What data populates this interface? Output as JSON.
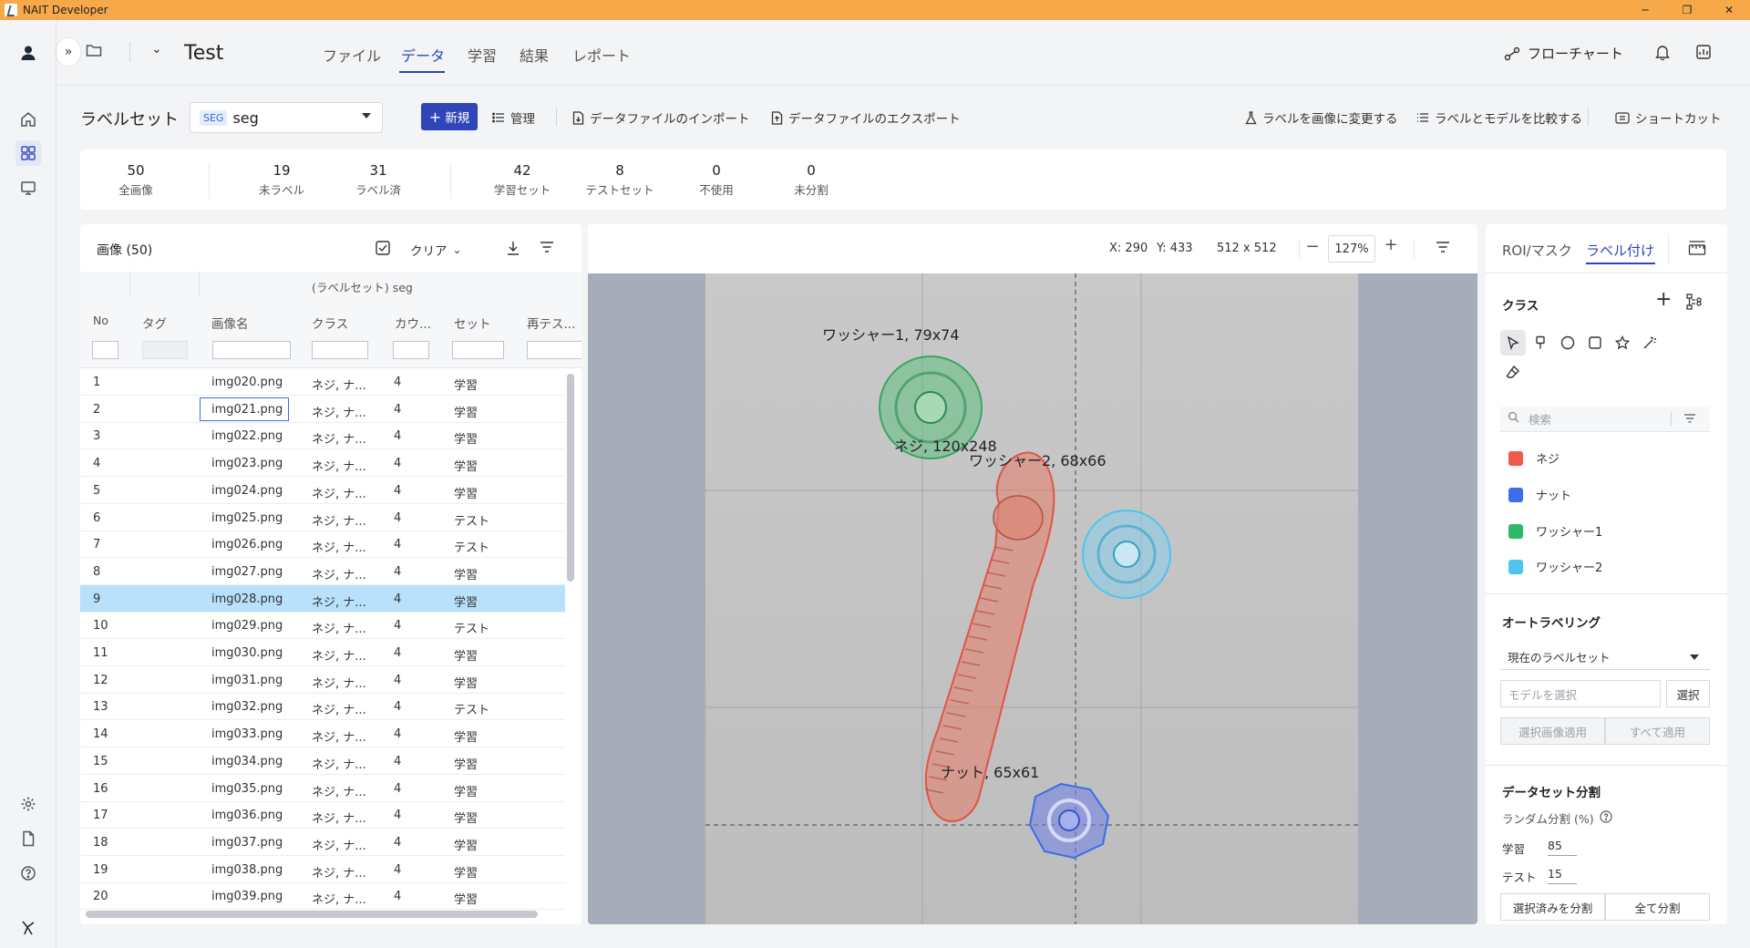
{
  "window": {
    "title": "NAIT Developer",
    "minimize": "─",
    "restore": "❐",
    "close": "✕"
  },
  "header": {
    "project": "Test",
    "menu": [
      "ファイル",
      "データ",
      "学習",
      "結果",
      "レポート"
    ],
    "flowchart": "フローチャート"
  },
  "toolbar": {
    "title": "ラベルセット",
    "badge": "SEG",
    "selected": "seg",
    "new": "新規",
    "manage": "管理",
    "import": "データファイルのインポート",
    "export": "データファイルのエクスポート",
    "change_to_image": "ラベルを画像に変更する",
    "compare": "ラベルとモデルを比較する",
    "shortcut": "ショートカット"
  },
  "stats": [
    {
      "num": "50",
      "label": "全画像"
    },
    {
      "num": "19",
      "label": "未ラベル"
    },
    {
      "num": "31",
      "label": "ラベル済"
    },
    {
      "num": "42",
      "label": "学習セット"
    },
    {
      "num": "8",
      "label": "テストセット"
    },
    {
      "num": "0",
      "label": "不使用"
    },
    {
      "num": "0",
      "label": "未分割"
    }
  ],
  "list": {
    "title": "画像 (50)",
    "clear": "クリア",
    "group_header": "(ラベルセット) seg",
    "columns": [
      "No",
      "タグ",
      "画像名",
      "クラス",
      "カウ...",
      "セット",
      "再テス..."
    ],
    "rows": [
      {
        "no": "1",
        "name": "img020.png",
        "cls": "ネジ, ナ...",
        "count": "4",
        "set": "学習"
      },
      {
        "no": "2",
        "name": "img021.png",
        "cls": "ネジ, ナ...",
        "count": "4",
        "set": "学習"
      },
      {
        "no": "3",
        "name": "img022.png",
        "cls": "ネジ, ナ...",
        "count": "4",
        "set": "学習"
      },
      {
        "no": "4",
        "name": "img023.png",
        "cls": "ネジ, ナ...",
        "count": "4",
        "set": "学習"
      },
      {
        "no": "5",
        "name": "img024.png",
        "cls": "ネジ, ナ...",
        "count": "4",
        "set": "学習"
      },
      {
        "no": "6",
        "name": "img025.png",
        "cls": "ネジ, ナ...",
        "count": "4",
        "set": "テスト"
      },
      {
        "no": "7",
        "name": "img026.png",
        "cls": "ネジ, ナ...",
        "count": "4",
        "set": "テスト"
      },
      {
        "no": "8",
        "name": "img027.png",
        "cls": "ネジ, ナ...",
        "count": "4",
        "set": "学習"
      },
      {
        "no": "9",
        "name": "img028.png",
        "cls": "ネジ, ナ...",
        "count": "4",
        "set": "学習"
      },
      {
        "no": "10",
        "name": "img029.png",
        "cls": "ネジ, ナ...",
        "count": "4",
        "set": "テスト"
      },
      {
        "no": "11",
        "name": "img030.png",
        "cls": "ネジ, ナ...",
        "count": "4",
        "set": "学習"
      },
      {
        "no": "12",
        "name": "img031.png",
        "cls": "ネジ, ナ...",
        "count": "4",
        "set": "学習"
      },
      {
        "no": "13",
        "name": "img032.png",
        "cls": "ネジ, ナ...",
        "count": "4",
        "set": "テスト"
      },
      {
        "no": "14",
        "name": "img033.png",
        "cls": "ネジ, ナ...",
        "count": "4",
        "set": "学習"
      },
      {
        "no": "15",
        "name": "img034.png",
        "cls": "ネジ, ナ...",
        "count": "4",
        "set": "学習"
      },
      {
        "no": "16",
        "name": "img035.png",
        "cls": "ネジ, ナ...",
        "count": "4",
        "set": "学習"
      },
      {
        "no": "17",
        "name": "img036.png",
        "cls": "ネジ, ナ...",
        "count": "4",
        "set": "学習"
      },
      {
        "no": "18",
        "name": "img037.png",
        "cls": "ネジ, ナ...",
        "count": "4",
        "set": "学習"
      },
      {
        "no": "19",
        "name": "img038.png",
        "cls": "ネジ, ナ...",
        "count": "4",
        "set": "学習"
      },
      {
        "no": "20",
        "name": "img039.png",
        "cls": "ネジ, ナ...",
        "count": "4",
        "set": "学習"
      }
    ]
  },
  "canvas": {
    "x": "X: 290",
    "y": "Y: 433",
    "size": "512 x 512",
    "zoom": "127%",
    "labels": {
      "washer1": "ワッシャー1, 79x74",
      "screw": "ネジ, 120x248",
      "washer2": "ワッシャー2, 68x66",
      "nut": "ナット, 65x61"
    }
  },
  "right": {
    "tabs": [
      "ROI/マスク",
      "ラベル付け"
    ],
    "class_title": "クラス",
    "search_placeholder": "検索",
    "classes": [
      {
        "name": "ネジ",
        "color": "#f05a4b"
      },
      {
        "name": "ナット",
        "color": "#3b6ee8"
      },
      {
        "name": "ワッシャー1",
        "color": "#2fb86a"
      },
      {
        "name": "ワッシャー2",
        "color": "#4fc4ef"
      }
    ],
    "auto_title": "オートラベリング",
    "auto_select": "現在のラベルセット",
    "model_placeholder": "モデルを選択",
    "select_btn": "選択",
    "apply_selected": "選択画像適用",
    "apply_all": "すべて適用",
    "split_title": "データセット分割",
    "random_split": "ランダム分割 (%)",
    "train_label": "学習",
    "train_value": "85",
    "test_label": "テスト",
    "test_value": "15",
    "split_selected": "選択済みを分割",
    "split_all": "全て分割"
  },
  "colors": {
    "accent": "#3046b8",
    "titlebar": "#f7a94a",
    "selected_row": "#b9e1fb"
  }
}
